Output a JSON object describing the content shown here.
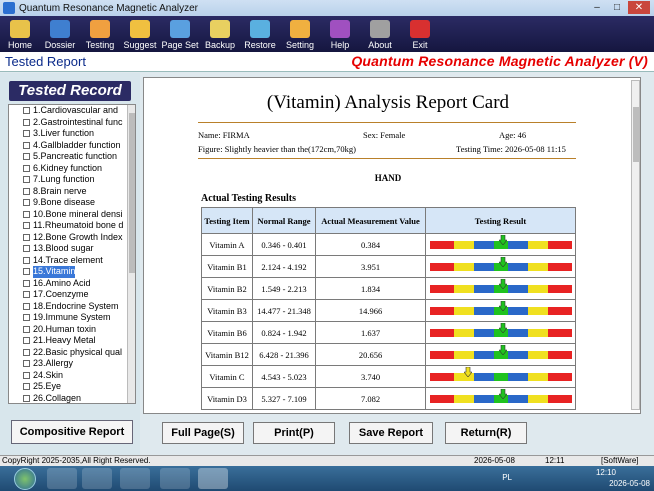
{
  "window": {
    "title": "Quantum Resonance Magnetic Analyzer"
  },
  "toolbar": {
    "items": [
      {
        "label": "Home",
        "icon": "home-icon"
      },
      {
        "label": "Dossier",
        "icon": "dossier-icon"
      },
      {
        "label": "Testing",
        "icon": "hand-icon"
      },
      {
        "label": "Suggest",
        "icon": "suggest-icon"
      },
      {
        "label": "Page Set",
        "icon": "page-set-icon"
      },
      {
        "label": "Backup",
        "icon": "backup-icon"
      },
      {
        "label": "Restore",
        "icon": "restore-icon"
      },
      {
        "label": "Setting",
        "icon": "gear-icon"
      },
      {
        "label": "Help",
        "icon": "help-icon"
      },
      {
        "label": "About",
        "icon": "about-icon"
      },
      {
        "label": "Exit",
        "icon": "exit-icon"
      }
    ]
  },
  "header": {
    "left": "Tested Report",
    "right": "Quantum Resonance Magnetic Analyzer (V)"
  },
  "sidebar": {
    "title": "Tested Record",
    "items": [
      "1.Cardiovascular and",
      "2.Gastrointestinal func",
      "3.Liver function",
      "4.Gallbladder function",
      "5.Pancreatic function",
      "6.Kidney function",
      "7.Lung function",
      "8.Brain nerve",
      "9.Bone disease",
      "10.Bone mineral densi",
      "11.Rheumatoid bone d",
      "12.Bone Growth Index",
      "13.Blood sugar",
      "14.Trace element",
      "15.Vitamin",
      "16.Amino Acid",
      "17.Coenzyme",
      "18.Endocrine System",
      "19.Immune System",
      "20.Human toxin",
      "21.Heavy Metal",
      "22.Basic physical qual",
      "23.Allergy",
      "24.Skin",
      "25.Eye",
      "26.Collagen"
    ],
    "selected_index": 14,
    "compositive_button": "Compositive Report"
  },
  "report": {
    "title": "(Vitamin) Analysis Report Card",
    "name": "Name: FIRMA",
    "sex": "Sex: Female",
    "age": "Age: 46",
    "figure": "Figure: Slightly heavier than the(172cm,70kg)",
    "testing_time": "Testing Time: 2026-05-08 11:15",
    "section": "HAND",
    "actual_heading": "Actual Testing Results",
    "columns": [
      "Testing Item",
      "Normal Range",
      "Actual Measurement Value",
      "Testing Result"
    ],
    "rows": [
      {
        "item": "Vitamin A",
        "range": "0.346 - 0.401",
        "value": "0.384",
        "marker": 0.52
      },
      {
        "item": "Vitamin B1",
        "range": "2.124 - 4.192",
        "value": "3.951",
        "marker": 0.52
      },
      {
        "item": "Vitamin B2",
        "range": "1.549 - 2.213",
        "value": "1.834",
        "marker": 0.52
      },
      {
        "item": "Vitamin B3",
        "range": "14.477 - 21.348",
        "value": "14.966",
        "marker": 0.52
      },
      {
        "item": "Vitamin B6",
        "range": "0.824 - 1.942",
        "value": "1.637",
        "marker": 0.52
      },
      {
        "item": "Vitamin B12",
        "range": "6.428 - 21.396",
        "value": "20.656",
        "marker": 0.52
      },
      {
        "item": "Vitamin C",
        "range": "4.543 - 5.023",
        "value": "3.740",
        "marker": 0.27
      },
      {
        "item": "Vitamin D3",
        "range": "5.327 - 7.109",
        "value": "7.082",
        "marker": 0.52
      }
    ],
    "bar_colors": [
      "#e82323",
      "#f0e020",
      "#2a68c8",
      "#1fc21f",
      "#2a68c8",
      "#f0e020",
      "#e82323"
    ],
    "marker_colors": {
      "normal": "#1fc21f",
      "low": "#f0e020"
    }
  },
  "buttons": {
    "full_page": "Full Page(S)",
    "print": "Print(P)",
    "save": "Save Report",
    "return": "Return(R)"
  },
  "status": {
    "copyright": "CopyRight 2025-2035,All Right Reserved.",
    "date": "2026-05-08",
    "time": "12:11",
    "mode": "[SoftWare]"
  },
  "taskbar": {
    "lang": "PL",
    "clock_time": "12:10",
    "clock_date": "2026-05-08"
  }
}
